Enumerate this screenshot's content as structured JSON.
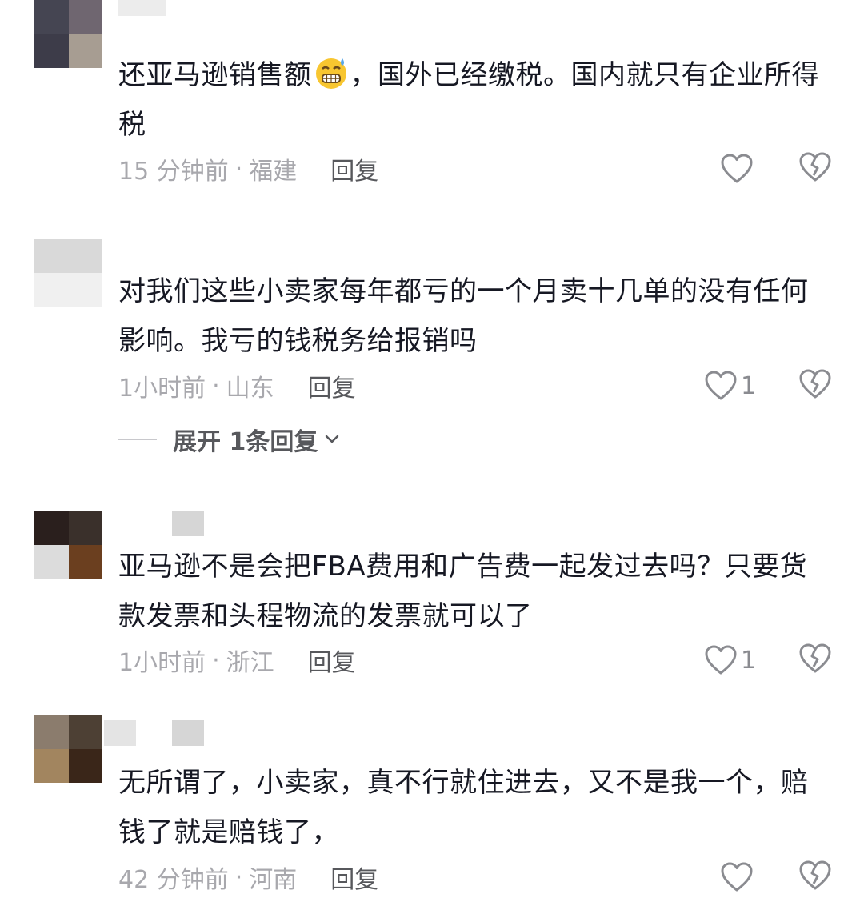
{
  "comments": [
    {
      "text": "还亚马逊销售额",
      "emoji": "grimacing-sweat-emoji",
      "text_after": "，国外已经缴税。国内就只有企业所得税",
      "time": "15 分钟前",
      "location": "福建",
      "reply_label": "回复",
      "likes": ""
    },
    {
      "text": "对我们这些小卖家每年都亏的一个月卖十几单的没有任何影响。我亏的钱税务给报销吗",
      "time": "1小时前",
      "location": "山东",
      "reply_label": "回复",
      "likes": "1",
      "expand_label": "展开 1条回复"
    },
    {
      "text": "亚马逊不是会把FBA费用和广告费一起发过去吗？只要货款发票和头程物流的发票就可以了",
      "time": "1小时前",
      "location": "浙江",
      "reply_label": "回复",
      "likes": "1"
    },
    {
      "text": "无所谓了，小卖家，真不行就住进去，又不是我一个，赔钱了就是赔钱了，",
      "time": "42 分钟前",
      "location": "河南",
      "reply_label": "回复",
      "likes": ""
    }
  ],
  "separator": "·",
  "colors": {
    "text": "#161823",
    "meta": "#a8a8ad",
    "reply": "#57585c",
    "icon": "#8a8b90"
  },
  "icons": {
    "like": "heart-outline-icon",
    "dislike": "broken-heart-icon",
    "expand": "chevron-down-icon"
  }
}
